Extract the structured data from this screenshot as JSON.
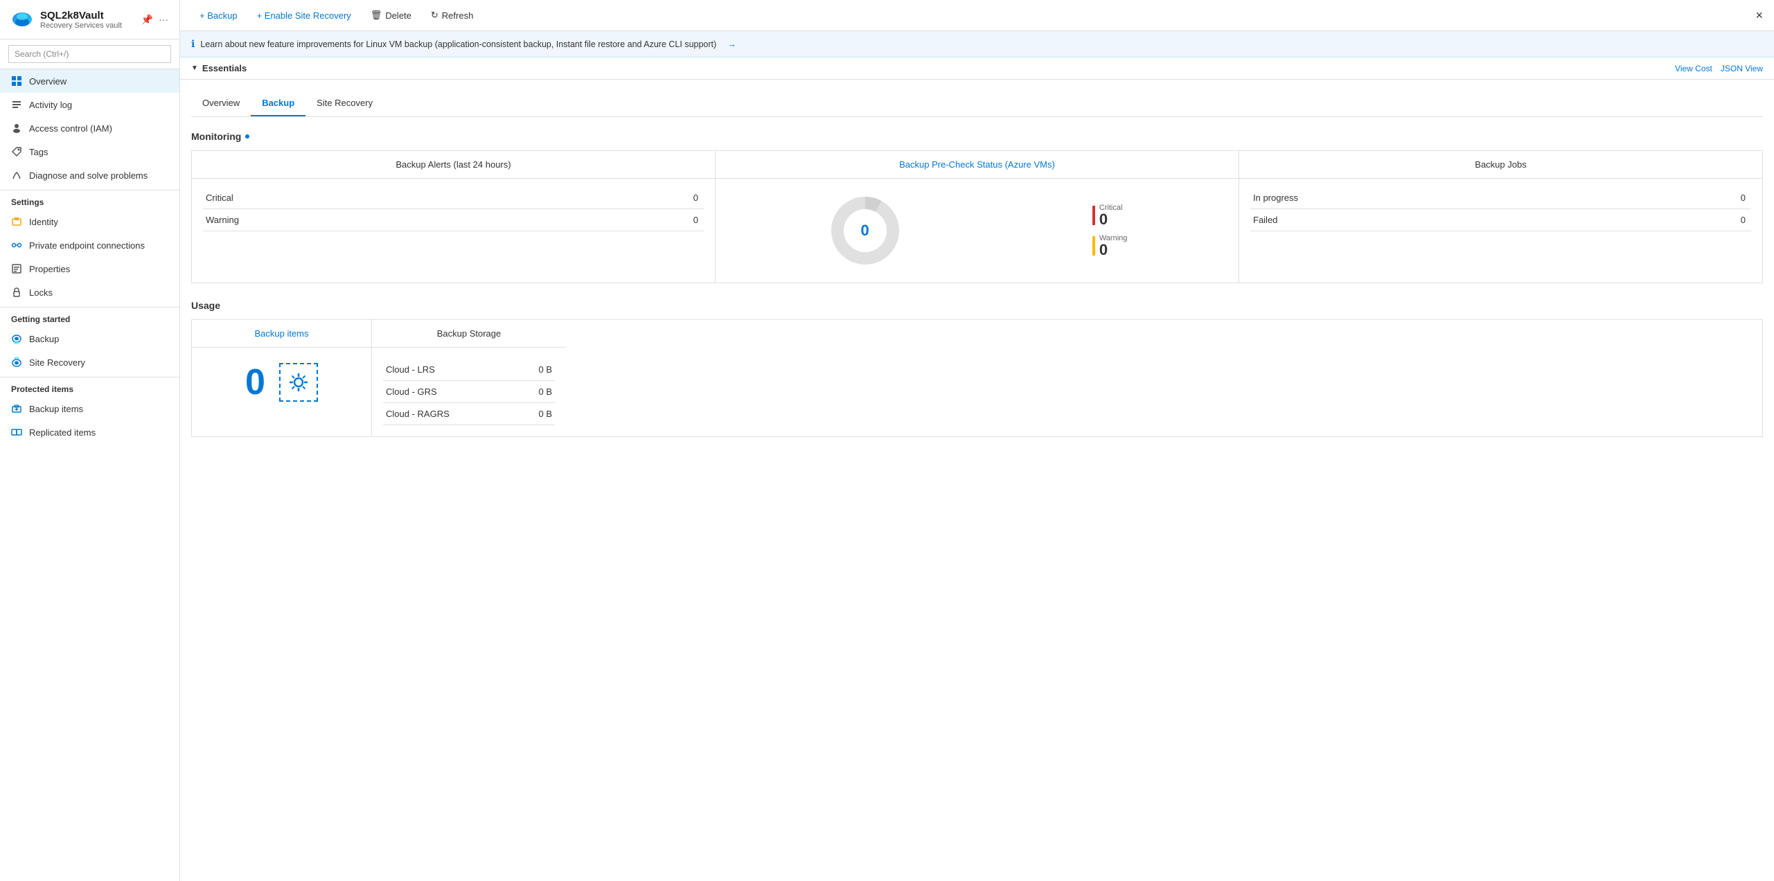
{
  "app": {
    "title": "SQL2k8Vault",
    "subtitle": "Recovery Services vault",
    "close_label": "×"
  },
  "sidebar": {
    "search_placeholder": "Search (Ctrl+/)",
    "collapse_icon": "«",
    "nav_items": [
      {
        "id": "overview",
        "label": "Overview",
        "icon": "overview",
        "active": true
      },
      {
        "id": "activity-log",
        "label": "Activity log",
        "icon": "log"
      },
      {
        "id": "access-control",
        "label": "Access control (IAM)",
        "icon": "iam"
      },
      {
        "id": "tags",
        "label": "Tags",
        "icon": "tags"
      },
      {
        "id": "diagnose",
        "label": "Diagnose and solve problems",
        "icon": "diagnose"
      }
    ],
    "sections": [
      {
        "label": "Settings",
        "items": [
          {
            "id": "identity",
            "label": "Identity",
            "icon": "identity"
          },
          {
            "id": "private-endpoints",
            "label": "Private endpoint connections",
            "icon": "endpoints"
          },
          {
            "id": "properties",
            "label": "Properties",
            "icon": "properties"
          },
          {
            "id": "locks",
            "label": "Locks",
            "icon": "locks"
          }
        ]
      },
      {
        "label": "Getting started",
        "items": [
          {
            "id": "backup",
            "label": "Backup",
            "icon": "backup"
          },
          {
            "id": "site-recovery",
            "label": "Site Recovery",
            "icon": "site-recovery"
          }
        ]
      },
      {
        "label": "Protected items",
        "items": [
          {
            "id": "backup-items",
            "label": "Backup items",
            "icon": "backup-items"
          },
          {
            "id": "replicated-items",
            "label": "Replicated items",
            "icon": "replicated"
          }
        ]
      }
    ]
  },
  "toolbar": {
    "backup_label": "+ Backup",
    "enable_site_recovery_label": "+ Enable Site Recovery",
    "delete_label": "Delete",
    "refresh_label": "Refresh"
  },
  "info_banner": {
    "text": "Learn about new feature improvements for Linux VM backup (application-consistent backup, Instant file restore and Azure CLI support)",
    "arrow": "→"
  },
  "essentials": {
    "label": "Essentials",
    "view_cost_label": "View Cost",
    "json_view_label": "JSON View"
  },
  "tabs": [
    {
      "id": "overview",
      "label": "Overview"
    },
    {
      "id": "backup",
      "label": "Backup",
      "active": true
    },
    {
      "id": "site-recovery",
      "label": "Site Recovery"
    }
  ],
  "monitoring": {
    "section_title": "Monitoring",
    "backup_alerts": {
      "header": "Backup Alerts (last 24 hours)",
      "rows": [
        {
          "label": "Critical",
          "value": "0"
        },
        {
          "label": "Warning",
          "value": "0"
        }
      ]
    },
    "pre_check": {
      "header": "Backup Pre-Check Status (Azure VMs)",
      "center_value": "0",
      "legend": [
        {
          "type": "critical",
          "label": "Critical",
          "value": "0"
        },
        {
          "type": "warning",
          "label": "Warning",
          "value": "0"
        }
      ]
    },
    "backup_jobs": {
      "header": "Backup Jobs",
      "rows": [
        {
          "label": "In progress",
          "value": "0"
        },
        {
          "label": "Failed",
          "value": "0"
        }
      ]
    }
  },
  "usage": {
    "section_title": "Usage",
    "backup_items": {
      "header": "Backup items",
      "count": "0",
      "icon_label": "⚙"
    },
    "backup_storage": {
      "header": "Backup Storage",
      "rows": [
        {
          "label": "Cloud - LRS",
          "value": "0 B"
        },
        {
          "label": "Cloud - GRS",
          "value": "0 B"
        },
        {
          "label": "Cloud - RAGRS",
          "value": "0 B"
        }
      ]
    }
  }
}
